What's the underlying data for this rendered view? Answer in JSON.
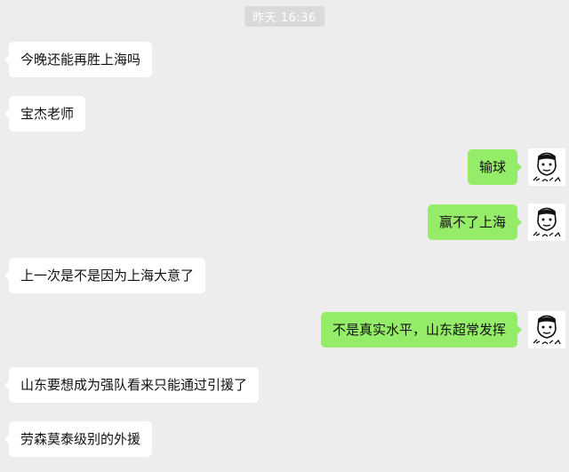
{
  "chat": {
    "timestamp": "昨天 16:36",
    "messages": [
      {
        "side": "left",
        "text": "今晚还能再胜上海吗"
      },
      {
        "side": "left",
        "text": "宝杰老师"
      },
      {
        "side": "right",
        "text": "输球"
      },
      {
        "side": "right",
        "text": "赢不了上海"
      },
      {
        "side": "left",
        "text": "上一次是不是因为上海大意了"
      },
      {
        "side": "right",
        "text": "不是真实水平，山东超常发挥"
      },
      {
        "side": "left",
        "text": "山东要想成为强队看来只能通过引援了"
      },
      {
        "side": "left",
        "text": "劳森莫泰级别的外援"
      }
    ]
  },
  "colors": {
    "background": "#ededed",
    "self_bubble": "#95ec69",
    "other_bubble": "#ffffff"
  },
  "avatar_icon": "cartoon-face-sticker"
}
